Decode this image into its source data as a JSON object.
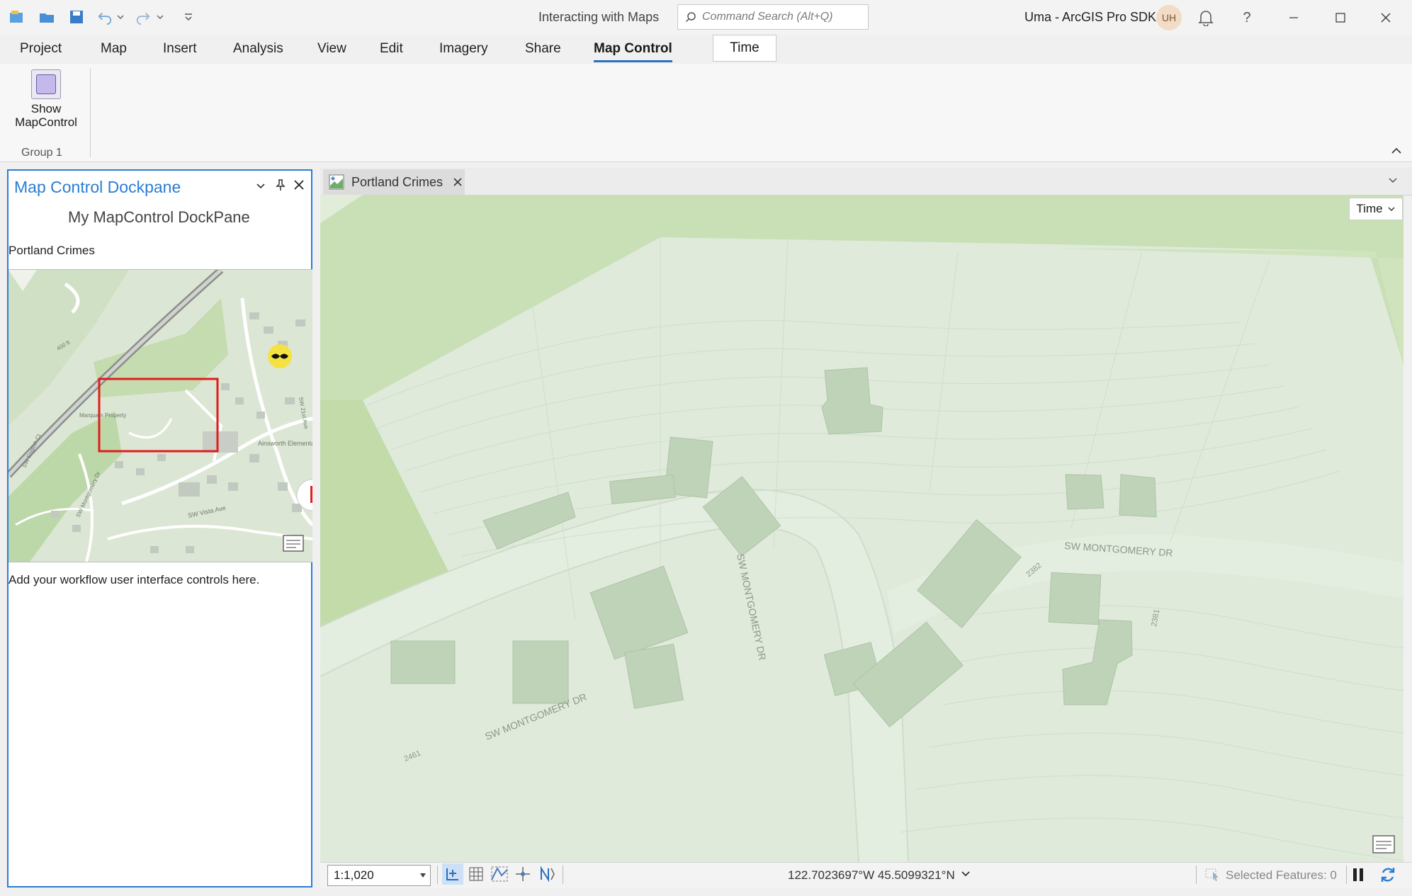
{
  "window": {
    "title": "Interacting with Maps",
    "user": "Uma - ArcGIS Pro SDK",
    "avatar_initials": "UH"
  },
  "search": {
    "placeholder": "Command Search (Alt+Q)"
  },
  "ribbon": {
    "tabs": [
      {
        "label": "Project"
      },
      {
        "label": "Map"
      },
      {
        "label": "Insert"
      },
      {
        "label": "Analysis"
      },
      {
        "label": "View"
      },
      {
        "label": "Edit"
      },
      {
        "label": "Imagery"
      },
      {
        "label": "Share"
      },
      {
        "label": "Map Control",
        "active": true
      },
      {
        "label": "Time"
      }
    ],
    "button_show_line1": "Show",
    "button_show_line2": "MapControl",
    "group_label": "Group 1"
  },
  "dockpane": {
    "title": "Map Control Dockpane",
    "heading": "My MapControl DockPane",
    "map_label": "Portland Crimes",
    "workflow_text": "Add your workflow user interface controls here.",
    "mini_map_labels": {
      "contour": "400 ft",
      "park": "Marquam Property",
      "school": "Ainsworth Elementary",
      "street_vista": "SW Vista Ave",
      "street_montgomery": "SW Montgomery Dr",
      "street_elm": "SW 21st Ave",
      "street_english": "SW English Ct"
    }
  },
  "mapview": {
    "tab_label": "Portland Crimes",
    "time_dropdown": "Time",
    "street_labels": [
      "SW MONTGOMERY DR",
      "SW MONTGOMERY DR",
      "SW MONTGOMERY DR"
    ],
    "address_labels": [
      "2461",
      "2382",
      "2381"
    ]
  },
  "statusbar": {
    "scale": "1:1,020",
    "coordinates": "122.7023697°W 45.5099321°N",
    "selected_features": "Selected Features: 0"
  },
  "colors": {
    "accent": "#2a7dd4",
    "active_tab_underline": "#2a6fbd",
    "map_green": "#dde9d6",
    "extent_red": "#e21b1b"
  }
}
